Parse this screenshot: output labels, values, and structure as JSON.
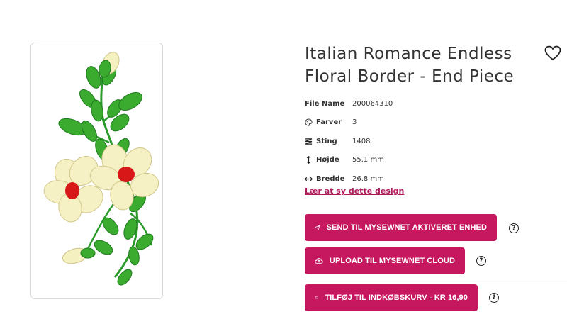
{
  "product": {
    "title_line1": "Italian Romance Endless",
    "title_line2": "Floral Border - End Piece"
  },
  "specs": [
    {
      "label": "File Name",
      "value": "200064310",
      "icon": "none"
    },
    {
      "label": "Farver",
      "value": "3",
      "icon": "palette-icon"
    },
    {
      "label": "Sting",
      "value": "1408",
      "icon": "stitch-icon"
    },
    {
      "label": "Højde",
      "value": "55.1 mm",
      "icon": "height-arrow-icon"
    },
    {
      "label": "Bredde",
      "value": "26.8 mm",
      "icon": "width-arrow-icon"
    }
  ],
  "learn_link": "Lær at sy dette design",
  "buttons": {
    "send": "SEND TIL MYSEWNET AKTIVERET ENHED",
    "upload": "UPLOAD TIL MYSEWNET CLOUD",
    "cart": "TILFØJ TIL INDKØBSKURV - KR 16,90"
  },
  "help_glyph": "?",
  "colors": {
    "accent": "#c5185f",
    "link": "#b0195c",
    "leaf": "#2e9e2e",
    "petal": "#f4f0c0",
    "center": "#d81818"
  }
}
